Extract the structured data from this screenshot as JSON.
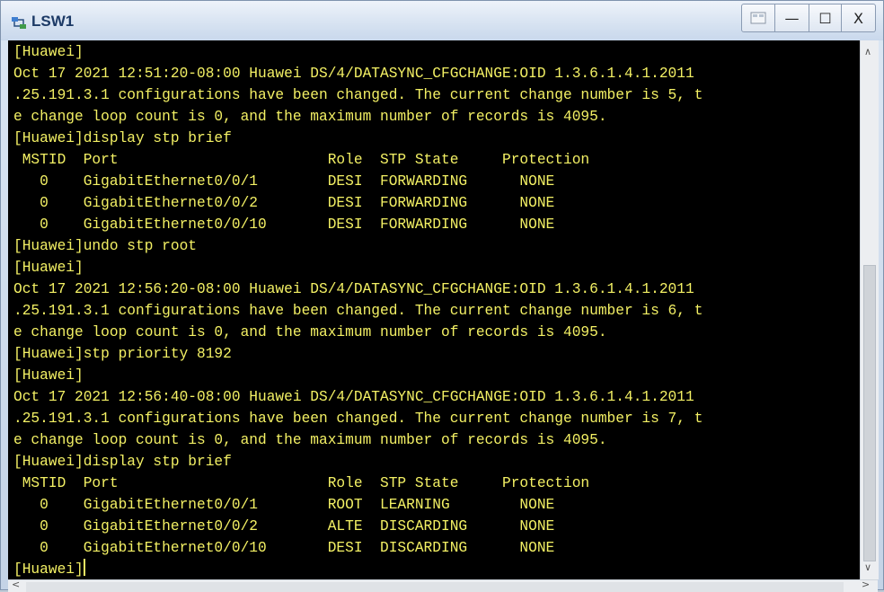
{
  "window": {
    "title": "LSW1",
    "icon": "switch-network-icon",
    "buttons": {
      "extra_icon": "window-extra-icon",
      "minimize": "—",
      "maximize": "☐",
      "close": "X"
    }
  },
  "terminal": {
    "text_color": "#f3f064",
    "background": "#000000",
    "lines": [
      "[Huawei]",
      "Oct 17 2021 12:51:20-08:00 Huawei DS/4/DATASYNC_CFGCHANGE:OID 1.3.6.1.4.1.2011",
      ".25.191.3.1 configurations have been changed. The current change number is 5, t",
      "e change loop count is 0, and the maximum number of records is 4095.",
      "[Huawei]display stp brief",
      " MSTID  Port                        Role  STP State     Protection",
      "   0    GigabitEthernet0/0/1        DESI  FORWARDING      NONE",
      "   0    GigabitEthernet0/0/2        DESI  FORWARDING      NONE",
      "   0    GigabitEthernet0/0/10       DESI  FORWARDING      NONE",
      "[Huawei]undo stp root",
      "[Huawei]",
      "Oct 17 2021 12:56:20-08:00 Huawei DS/4/DATASYNC_CFGCHANGE:OID 1.3.6.1.4.1.2011",
      ".25.191.3.1 configurations have been changed. The current change number is 6, t",
      "e change loop count is 0, and the maximum number of records is 4095.",
      "[Huawei]stp priority 8192",
      "[Huawei]",
      "Oct 17 2021 12:56:40-08:00 Huawei DS/4/DATASYNC_CFGCHANGE:OID 1.3.6.1.4.1.2011",
      ".25.191.3.1 configurations have been changed. The current change number is 7, t",
      "e change loop count is 0, and the maximum number of records is 4095.",
      "[Huawei]display stp brief",
      " MSTID  Port                        Role  STP State     Protection",
      "   0    GigabitEthernet0/0/1        ROOT  LEARNING        NONE",
      "   0    GigabitEthernet0/0/2        ALTE  DISCARDING      NONE",
      "   0    GigabitEthernet0/0/10       DESI  DISCARDING      NONE"
    ],
    "prompt": "[Huawei]"
  }
}
